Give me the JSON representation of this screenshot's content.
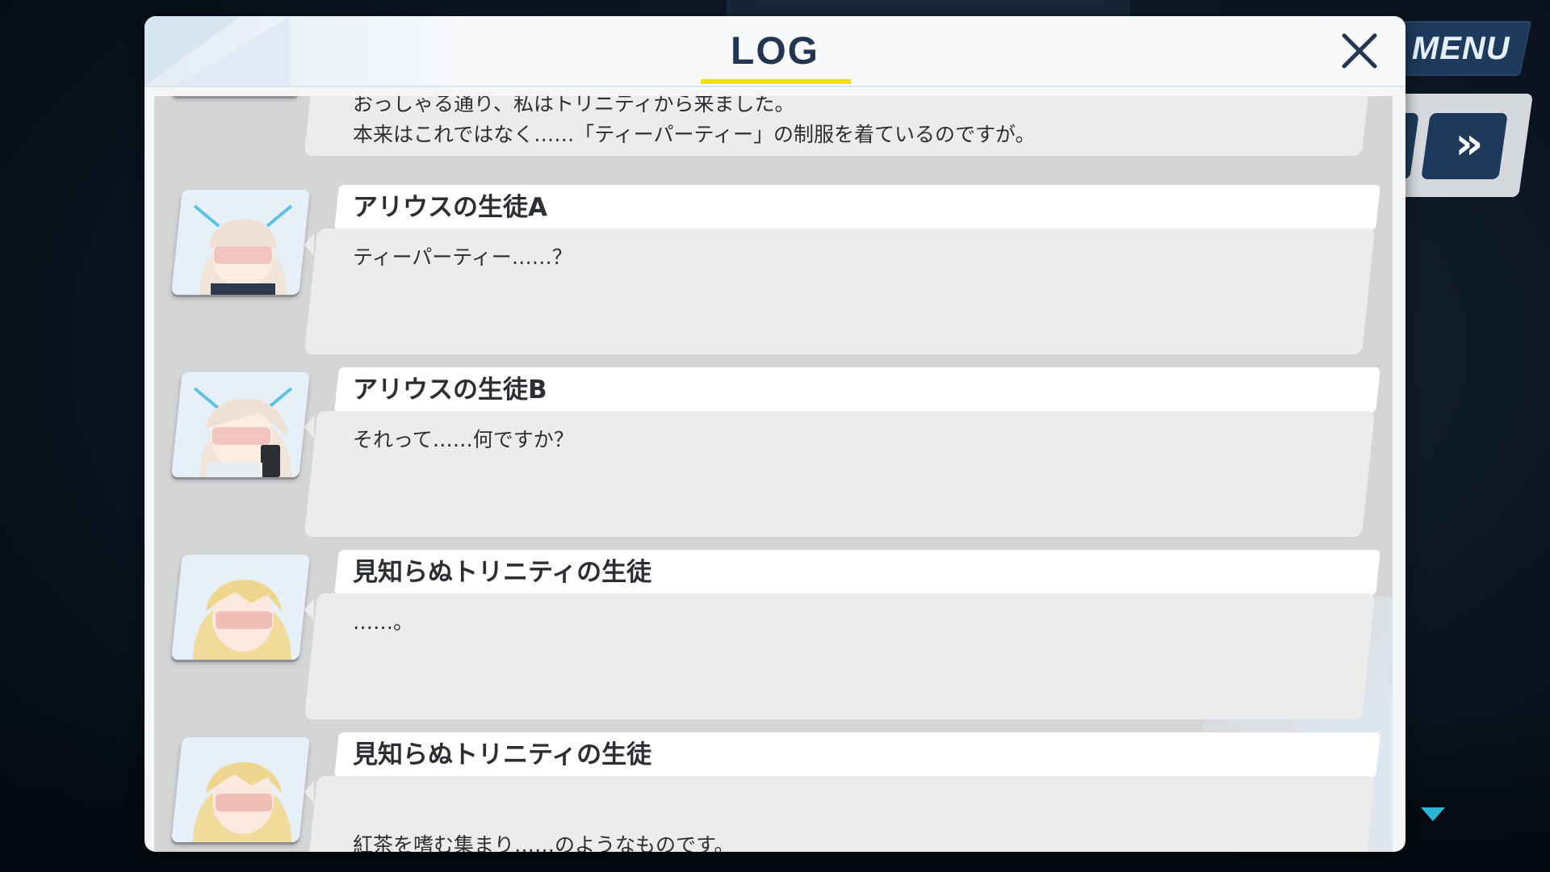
{
  "menu": {
    "label": "MENU"
  },
  "controls": {
    "skip_label": "»"
  },
  "log": {
    "title": "LOG",
    "entries": [
      {
        "speaker": "",
        "lines": [
          "おっしゃる通り、私はトリニティから来ました。",
          "本来はこれではなく……「ティーパーティー」の制服を着ているのですが。"
        ]
      },
      {
        "speaker": "アリウスの生徒A",
        "lines": [
          "ティーパーティー……？"
        ]
      },
      {
        "speaker": "アリウスの生徒B",
        "lines": [
          "それって……何ですか？"
        ]
      },
      {
        "speaker": "見知らぬトリニティの生徒",
        "lines": [
          "……。"
        ]
      },
      {
        "speaker": "見知らぬトリニティの生徒",
        "lines": [
          "紅茶を嗜む集まり……のようなものです。"
        ]
      }
    ]
  },
  "colors": {
    "accent_yellow": "#f2e200",
    "navy": "#1d3a5c",
    "scroll_indicator": "#2ab6d6"
  }
}
